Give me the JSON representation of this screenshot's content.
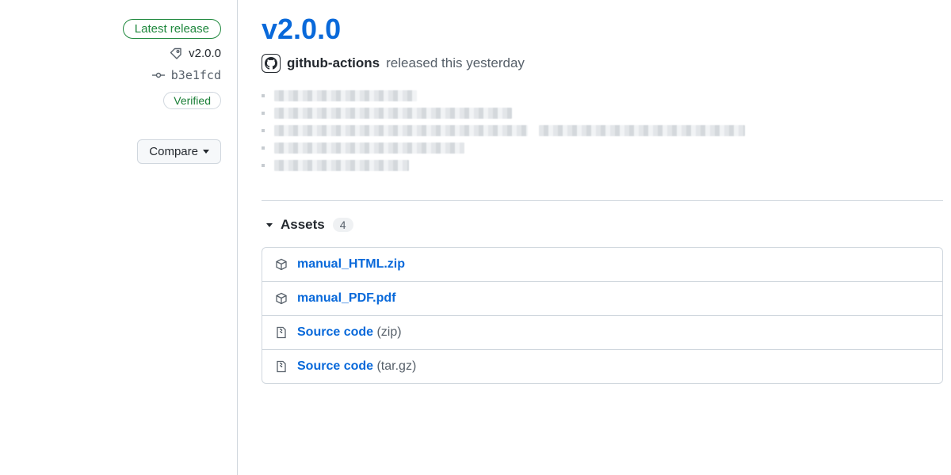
{
  "sidebar": {
    "latest_release_label": "Latest release",
    "tag_name": "v2.0.0",
    "commit_sha": "b3e1fcd",
    "verified_label": "Verified",
    "compare_label": "Compare"
  },
  "release": {
    "title": "v2.0.0",
    "author_name": "github-actions",
    "author_action_text": "released this yesterday"
  },
  "assets_section": {
    "label": "Assets",
    "count": "4"
  },
  "assets": [
    {
      "icon": "package",
      "name": "manual_HTML.zip",
      "suffix": ""
    },
    {
      "icon": "package",
      "name": "manual_PDF.pdf",
      "suffix": ""
    },
    {
      "icon": "zip",
      "name": "Source code",
      "suffix": " (zip)"
    },
    {
      "icon": "zip",
      "name": "Source code",
      "suffix": " (tar.gz)"
    }
  ]
}
